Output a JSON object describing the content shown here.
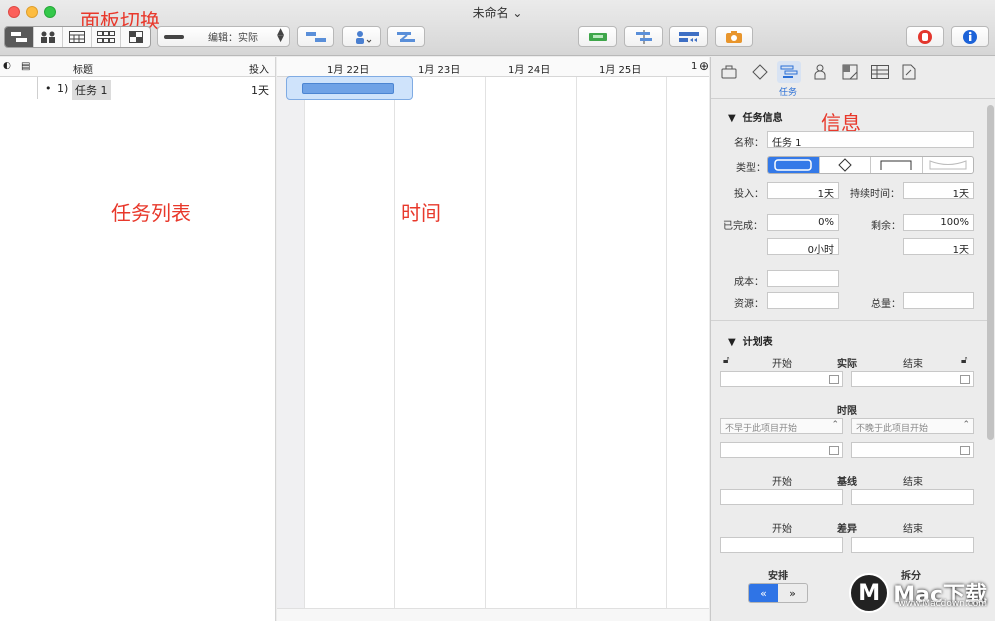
{
  "window": {
    "title": "未命名 ⌄"
  },
  "annotations": {
    "panel_switch": "面板切换",
    "task_list": "任务列表",
    "time": "时间",
    "info": "信息"
  },
  "toolbar": {
    "edit_mode": "编辑：实际",
    "panel_views": [
      "gantt-view-icon",
      "resource-view-icon",
      "calendar-view-icon",
      "network-view-icon",
      "style-view-icon"
    ]
  },
  "outline": {
    "columns": {
      "title": "标题",
      "effort": "投入"
    },
    "tasks": [
      {
        "bullet": "•",
        "number": "1)",
        "name": "任务 1",
        "effort": "1天"
      }
    ]
  },
  "gantt": {
    "days": [
      "1月 22日",
      "1月 23日",
      "1月 24日",
      "1月 25日",
      "1"
    ]
  },
  "inspector": {
    "active_tab_label": "任务",
    "task_info": {
      "title": "任务信息",
      "name_label": "名称：",
      "name_value": "任务 1",
      "type_label": "类型：",
      "effort_label": "投入：",
      "effort_value": "1天",
      "duration_label": "持续时间：",
      "duration_value": "1天",
      "completed_label": "已完成：",
      "completed_value": "0%",
      "remaining_label": "剩余：",
      "remaining_value": "100%",
      "completed_hours": "0小时",
      "remaining_days": "1天",
      "cost_label": "成本：",
      "resource_label": "资源：",
      "total_label": "总量："
    },
    "schedule": {
      "title": "计划表",
      "start": "开始",
      "actual": "实际",
      "end": "结束",
      "constraint": "时限",
      "not_earlier": "不早于此项目开始",
      "not_later": "不晚于此项目开始",
      "baseline_start": "开始",
      "baseline": "基线",
      "baseline_end": "结束",
      "variance_start": "开始",
      "variance": "差异",
      "variance_end": "结束",
      "arrange": "安排",
      "split": "拆分"
    }
  },
  "watermark": {
    "brand": "Mac下载",
    "url": "www.Macdown.com"
  },
  "colors": {
    "accent": "#3479e8",
    "annotation": "#e8382b",
    "gantt_bar": "#6fa2e6"
  }
}
